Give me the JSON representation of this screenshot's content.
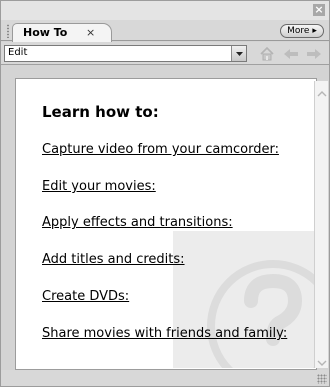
{
  "panel": {
    "tab_label": "How To",
    "tab_close_glyph": "×",
    "more_label": "More ▸",
    "window_close_glyph": "×"
  },
  "toolbar": {
    "topic_value": "Edit",
    "icons": [
      "dropdown-arrow-icon",
      "home-icon",
      "back-arrow-icon",
      "forward-arrow-icon"
    ]
  },
  "content": {
    "heading": "Learn how to:",
    "links": [
      "Capture video from your camcorder:",
      "Edit your movies:",
      "Apply effects and transitions:",
      "Add titles and credits:",
      "Create DVDs:",
      "Share movies with friends and family:"
    ],
    "watermark_icon": "question-mark-icon"
  },
  "colors": {
    "panel_bg": "#d4d4d4",
    "content_bg": "#ffffff",
    "watermark": "#ececec"
  }
}
